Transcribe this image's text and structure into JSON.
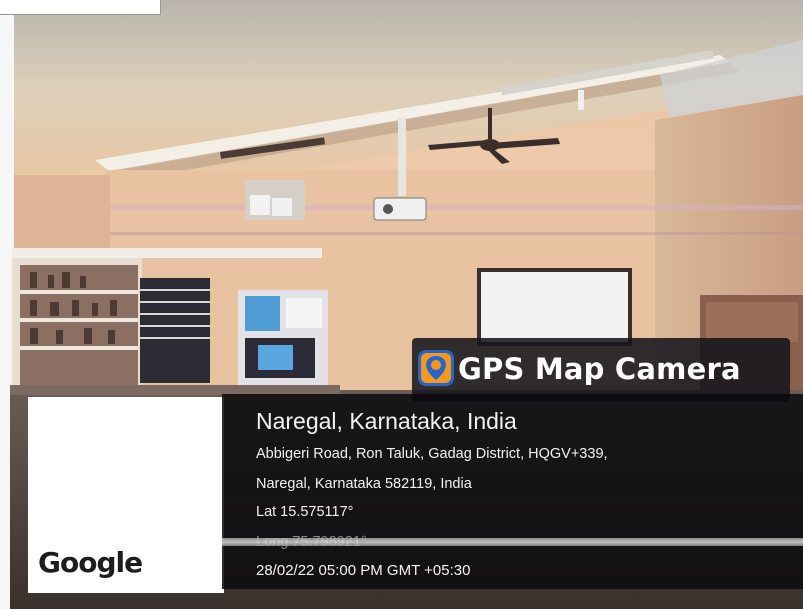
{
  "app_badge": {
    "title": "GPS Map Camera",
    "icon": "map-pin-icon"
  },
  "location_info": {
    "place": "Naregal, Karnataka, India",
    "address_line1": "Abbigeri Road, Ron Taluk, Gadag District, HQGV+339,",
    "address_line2": "Naregal, Karnataka 582119, India",
    "latitude": "Lat 15.575117°",
    "longitude": "Long 75.798921°",
    "datetime": "28/02/22 05:00 PM GMT +05:30"
  },
  "map_watermark": "Google",
  "scene": {
    "description_colors": {
      "ceiling": "#e9dcc4",
      "wall": "#e4bc9c",
      "board": "#f4f2f0",
      "panel_bg": "#16161c",
      "text": "#f3f3f3",
      "icon_orange": "#f29a1e",
      "icon_blue": "#2a64c8"
    }
  }
}
